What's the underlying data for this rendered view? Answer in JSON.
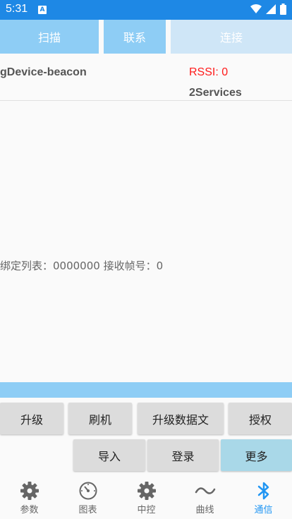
{
  "statusbar": {
    "time": "5:31",
    "app_icon_letter": "A"
  },
  "topbar": {
    "scan": "扫描",
    "contact": "联系",
    "connect": "连接"
  },
  "device": {
    "name": "gDevice-beacon",
    "rssi": "RSSI: 0",
    "services": "2Services"
  },
  "bind_list": "绑定列表：0000000   接收帧号：0",
  "buttons": {
    "upgrade": "升级",
    "flash": "刷机",
    "upgrade_data": "升级数据文",
    "authorize": "授权",
    "import": "导入",
    "login": "登录",
    "more": "更多"
  },
  "tabs": [
    {
      "label": "参数",
      "icon": "gear-icon"
    },
    {
      "label": "图表",
      "icon": "gauge-icon"
    },
    {
      "label": "中控",
      "icon": "gear-icon"
    },
    {
      "label": "曲线",
      "icon": "wave-icon"
    },
    {
      "label": "通信",
      "icon": "bluetooth-icon",
      "active": true
    }
  ],
  "colors": {
    "statusbar": "#1e88e5",
    "topbutton": "#8ecdf5",
    "topbutton_disabled": "#cfe6f7",
    "rssi": "#ff1a1a",
    "active_tab": "#2196f3"
  }
}
